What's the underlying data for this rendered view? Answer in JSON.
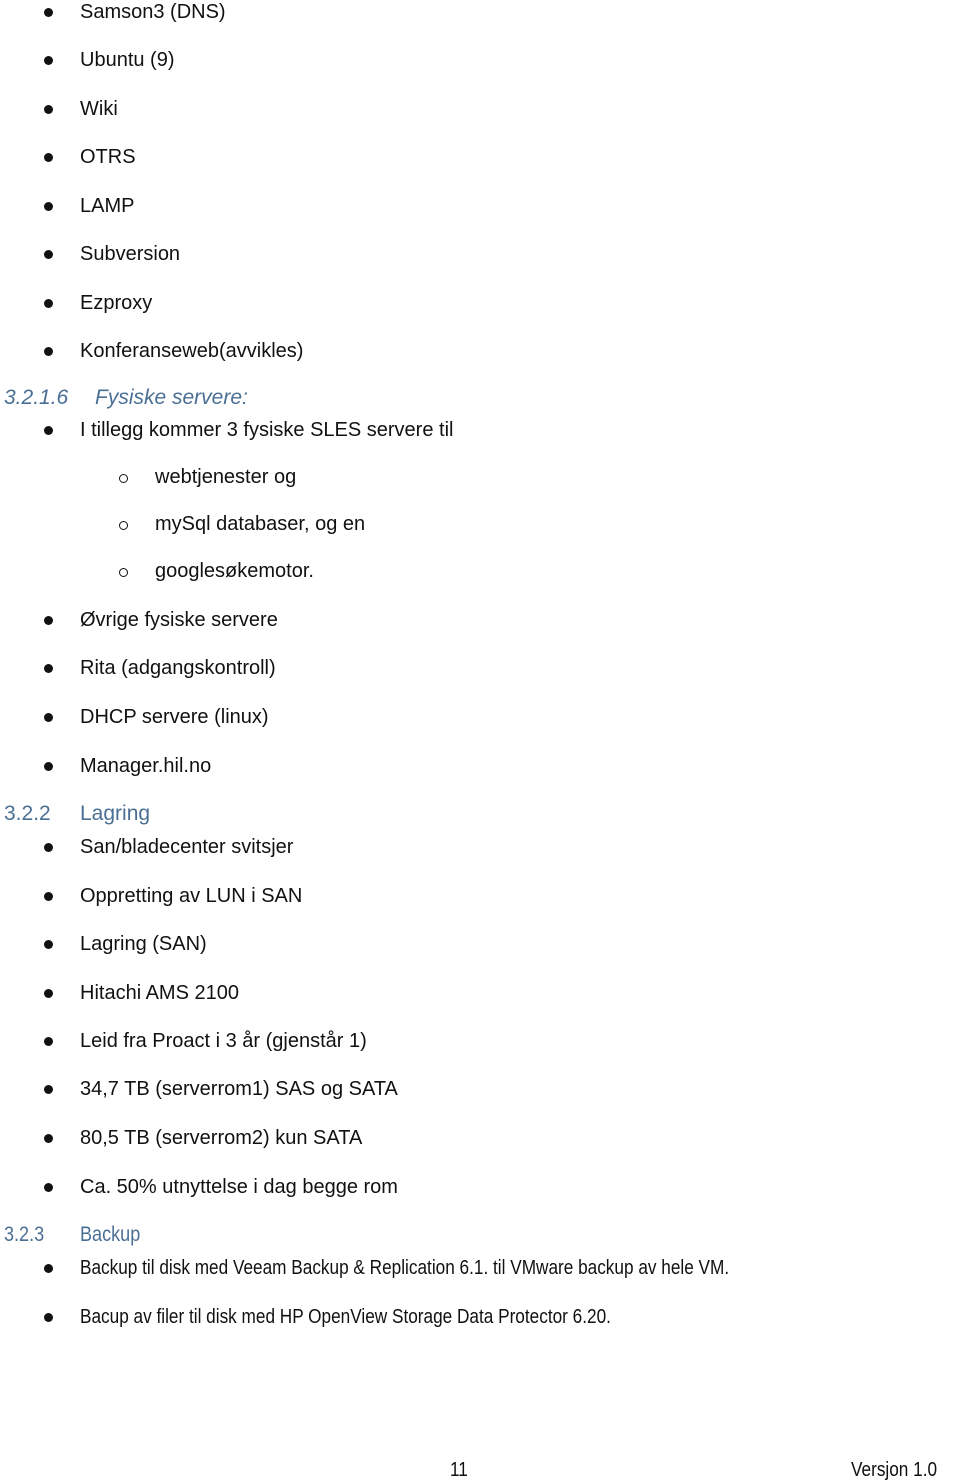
{
  "top_list": [
    "Samson3 (DNS)",
    "Ubuntu (9)",
    "Wiki",
    "OTRS",
    "LAMP",
    "Subversion",
    "Ezproxy",
    "Konferanseweb(avvikles)"
  ],
  "section_3216": {
    "number": "3.2.1.6",
    "title": "Fysiske servere:",
    "intro": "I tillegg kommer 3 fysiske SLES servere til",
    "sub_items": [
      "webtjenester og",
      "mySql databaser, og en",
      "googlesøkemotor."
    ],
    "items": [
      "Øvrige fysiske servere",
      "Rita (adgangskontroll)",
      "DHCP servere (linux)",
      "Manager.hil.no"
    ]
  },
  "section_322": {
    "number": "3.2.2",
    "title": "Lagring",
    "items": [
      "San/bladecenter svitsjer",
      "Oppretting av LUN i SAN",
      "Lagring (SAN)",
      "Hitachi AMS 2100",
      "Leid fra Proact i 3 år (gjenstår 1)",
      "34,7 TB (serverrom1) SAS og SATA",
      "80,5 TB (serverrom2) kun SATA",
      "Ca. 50% utnyttelse i dag begge rom"
    ]
  },
  "section_323": {
    "number": "3.2.3",
    "title": "Backup",
    "items": [
      "Backup til disk med Veeam Backup & Replication 6.1. til VMware backup av hele VM.",
      "Bacup av filer til disk med HP OpenView Storage Data Protector 6.20."
    ]
  },
  "footer": {
    "page_number": "11",
    "version": "Versjon 1.0"
  },
  "colors": {
    "heading": "#4a6f95",
    "text": "#111111"
  }
}
